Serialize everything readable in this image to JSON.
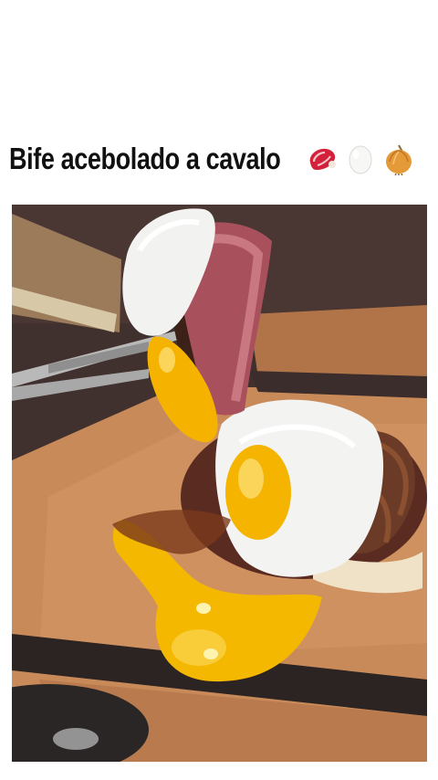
{
  "post": {
    "title": "Bife acebolado a cavalo",
    "emojis": [
      "meat-on-bone-icon",
      "egg-icon",
      "onion-icon"
    ]
  },
  "colors": {
    "background": "#ffffff",
    "title_text": "#111111",
    "yolk": "#f5b800",
    "board": "#c98a5a"
  }
}
